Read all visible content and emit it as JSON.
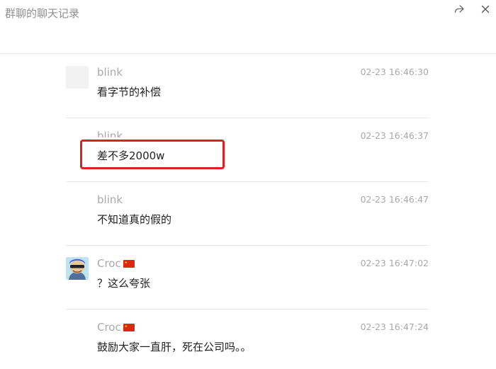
{
  "window": {
    "title": "群聊的聊天记录"
  },
  "toolbar": {
    "forward_icon": "forward-icon",
    "close_icon": "close-icon"
  },
  "messages": [
    {
      "sender": "blink",
      "time": "02-23 16:46:30",
      "content": "看字节的补偿",
      "avatar": "blank"
    },
    {
      "sender": "blink",
      "time": "02-23 16:46:37",
      "content": "差不多2000w",
      "avatar": "none"
    },
    {
      "sender": "blink",
      "time": "02-23 16:46:47",
      "content": "不知道真的假的",
      "avatar": "none"
    },
    {
      "sender": "Croc",
      "time": "02-23 16:47:02",
      "content": "？这么夸张",
      "avatar": "cartoon-avatar"
    },
    {
      "sender": "Croc",
      "time": "02-23 16:47:24",
      "content": "鼓励大家一直肝，死在公司吗。。",
      "avatar": "none"
    }
  ],
  "annotation": {
    "highlight_color": "#d9231c"
  },
  "colors": {
    "title": "#8f8f8f",
    "meta": "#a9a9a9",
    "text": "#1f1f1f",
    "divider": "#e7e7e7"
  }
}
